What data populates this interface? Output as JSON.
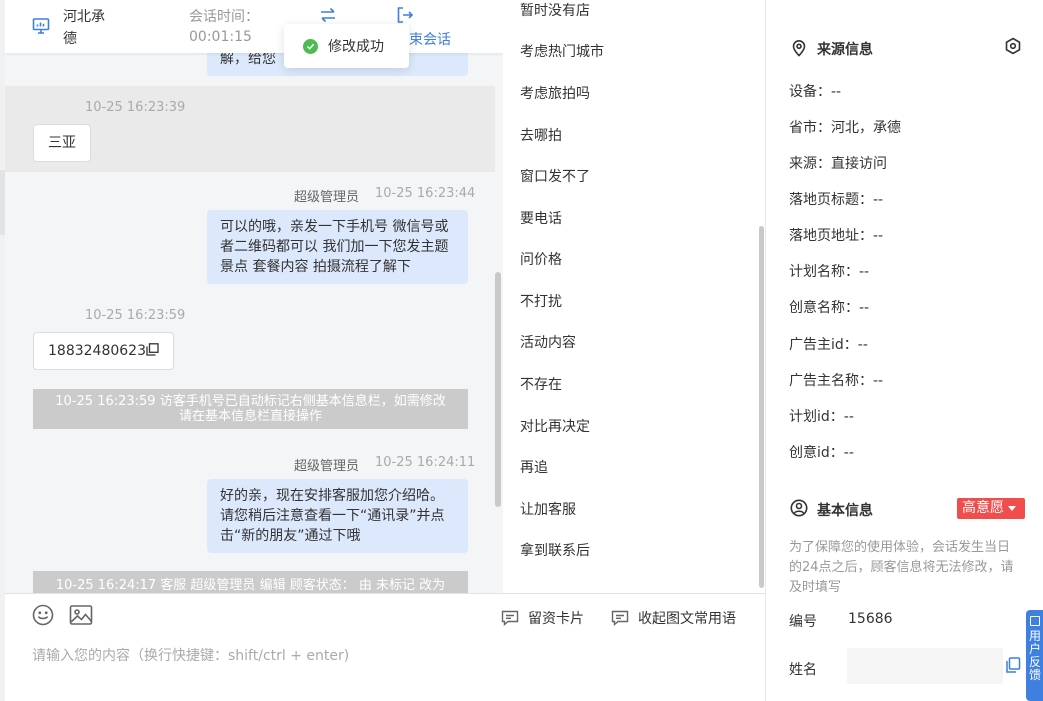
{
  "header": {
    "city": "河北承德",
    "session_time_label": "会话时间：",
    "session_time_value": "00:01:15",
    "end_session": "结束会话"
  },
  "toast": {
    "text": "修改成功"
  },
  "chat": {
    "messages": [
      {
        "kind": "agent",
        "text": "解，给您"
      },
      {
        "kind": "customer",
        "time": "10-25 16:23:39",
        "text": "三亚"
      },
      {
        "kind": "agent",
        "sender": "超级管理员",
        "time": "10-25 16:23:44",
        "lines": [
          "可以的哦，亲发一下手机号 微信号或",
          "者二维码都可以 我们加一下您发主题",
          "景点 套餐内容 拍摄流程了解下"
        ]
      },
      {
        "kind": "customer",
        "time": "10-25 16:23:59",
        "text": "18832480623"
      },
      {
        "kind": "system",
        "lines": [
          "10-25 16:23:59 访客手机号已自动标记右侧基本信息栏，如需修改",
          "请在基本信息栏直接操作"
        ]
      },
      {
        "kind": "agent",
        "sender": "超级管理员",
        "time": "10-25 16:24:11",
        "lines": [
          "好的亲，现在安排客服加您介绍哈。",
          "请您稍后注意查看一下“通讯录”并点",
          "击“新的朋友”通过下哦"
        ]
      },
      {
        "kind": "system",
        "lines": [
          "10-25 16:24:17 客服 超级管理员 编辑 顾客状态： 由 未标记 改为"
        ]
      }
    ]
  },
  "composer": {
    "card_label": "留资卡片",
    "phrases_label": "收起图文常用语",
    "placeholder": "请输入您的内容（换行快捷键：shift/ctrl + enter)"
  },
  "phrases": [
    "暂时没有店",
    "考虑热门城市",
    "考虑旅拍吗",
    "去哪拍",
    "窗口发不了",
    "要电话",
    "问价格",
    "不打扰",
    "活动内容",
    "不存在",
    "对比再决定",
    "再追",
    "让加客服",
    "拿到联系后"
  ],
  "source_info": {
    "title": "来源信息",
    "rows": [
      "设备：--",
      "省市：河北，承德",
      "来源：直接访问",
      "落地页标题：--",
      "落地页地址：--",
      "计划名称：--",
      "创意名称：--",
      "广告主id：--",
      "广告主名称：--",
      "计划id：--",
      "创意id：--"
    ]
  },
  "basic_info": {
    "title": "基本信息",
    "intent": "高意愿",
    "notice": "为了保障您的使用体验，会话发生当日的24点之后，顾客信息将无法修改，请及时填写",
    "number_label": "编号",
    "number_value": "15686",
    "name_label": "姓名"
  },
  "feedback_tab": {
    "text": "用户反馈"
  },
  "colors": {
    "accent": "#3f7fe0",
    "agent_bubble": "#dce8fc",
    "badge_red": "#f04d4d",
    "success_green": "#4cbb52"
  }
}
